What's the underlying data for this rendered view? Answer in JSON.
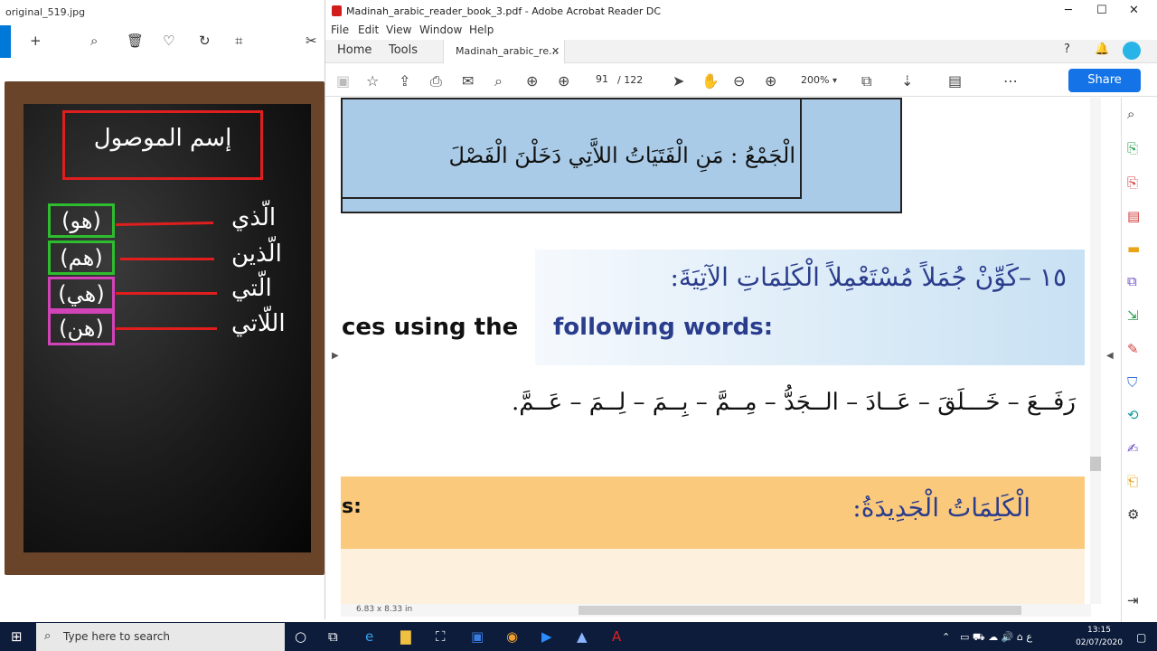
{
  "viewer": {
    "title": "original_519.jpg"
  },
  "board": {
    "title": "إسم الموصول",
    "rows": [
      {
        "pronoun": "(هو)",
        "relative": "الّذي",
        "color": "#2ebd2e"
      },
      {
        "pronoun": "(هم)",
        "relative": "الّذين",
        "color": "#2ebd2e"
      },
      {
        "pronoun": "(هي)",
        "relative": "الّتي",
        "color": "#d243b8"
      },
      {
        "pronoun": "(هن)",
        "relative": "اللّاتي",
        "color": "#d243b8"
      }
    ]
  },
  "acrobat": {
    "title": "Madinah_arabic_reader_book_3.pdf - Adobe Acrobat Reader DC",
    "menu": [
      "File",
      "Edit",
      "View",
      "Window",
      "Help"
    ],
    "tabs": {
      "home": "Home",
      "tools": "Tools",
      "doc": "Madinah_arabic_re..."
    },
    "page_current": "91",
    "page_total": "/ 122",
    "zoom": "200%",
    "share": "Share",
    "page_size": "6.83 x 8.33 in"
  },
  "doc": {
    "top_line": "الْجَمْعُ : مَنِ الْفَتَيَاتُ اللاَّتِي دَخَلْنَ الْفَصْلَ",
    "exercise_ar": "١٥ –كَوِّنْ جُمَلاً مُسْتَعْمِلاً الْكَلِمَاتِ الآتِيَةَ:",
    "exercise_en_a": "ces using the",
    "exercise_en_b": "following words:",
    "words": "رَفَــعَ – خَـــلَقَ – عَــادَ – الــجَدُّ – مِــمَّ – بِــمَ – لِــمَ – عَــمَّ.",
    "vocab_en": "s:",
    "vocab_ar": "الْكَلِمَاتُ الْجَدِيدَةُ:"
  },
  "taskbar": {
    "search": "Type here to search",
    "time": "13:15",
    "date": "02/07/2020"
  },
  "colors": {
    "accent": "#1473e6",
    "red": "#e01e1e"
  }
}
